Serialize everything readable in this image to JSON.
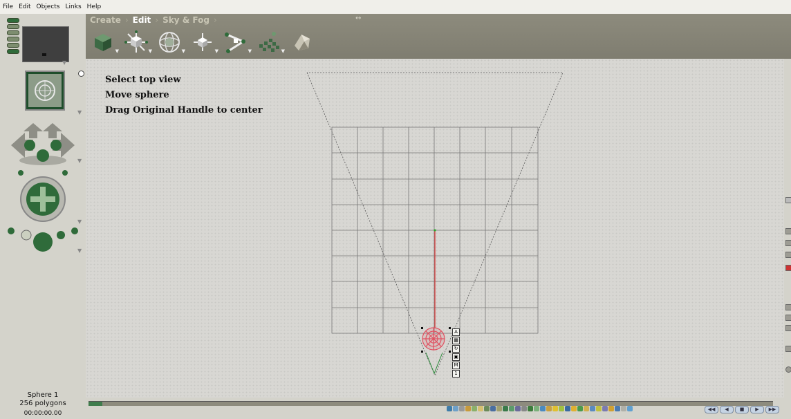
{
  "menu": [
    "File",
    "Edit",
    "Objects",
    "Links",
    "Help"
  ],
  "toolbar": {
    "tabs": [
      {
        "label": "Create",
        "active": false
      },
      {
        "label": "Edit",
        "active": true
      },
      {
        "label": "Sky & Fog",
        "active": false
      }
    ],
    "tools": [
      "cube-object-icon",
      "move-gizmo-icon",
      "sphere-wireframe-icon",
      "vertex-edit-icon",
      "magic-wand-icon",
      "grid-objects-icon",
      "rock-object-icon"
    ],
    "resize_icon": "↔"
  },
  "instructions": [
    "Select top view",
    "Move sphere",
    "Drag Original Handle to center"
  ],
  "status": {
    "object_name": "Sphere 1",
    "polygons": "256 polygons",
    "time": "00:00:00.00"
  },
  "object_buttons": [
    "A",
    "▦",
    "↻",
    "▣",
    "M",
    "1"
  ],
  "nav_buttons": [
    "◀◀",
    "◀",
    "■",
    "▶",
    "▶▶"
  ],
  "colors": {
    "toolbar_bg": "#8a8878",
    "panel_bg": "#d4d3cb",
    "viewport_bg": "#d8d7d3",
    "accent_green": "#2f6b3a",
    "sphere_red": "#e05060"
  }
}
